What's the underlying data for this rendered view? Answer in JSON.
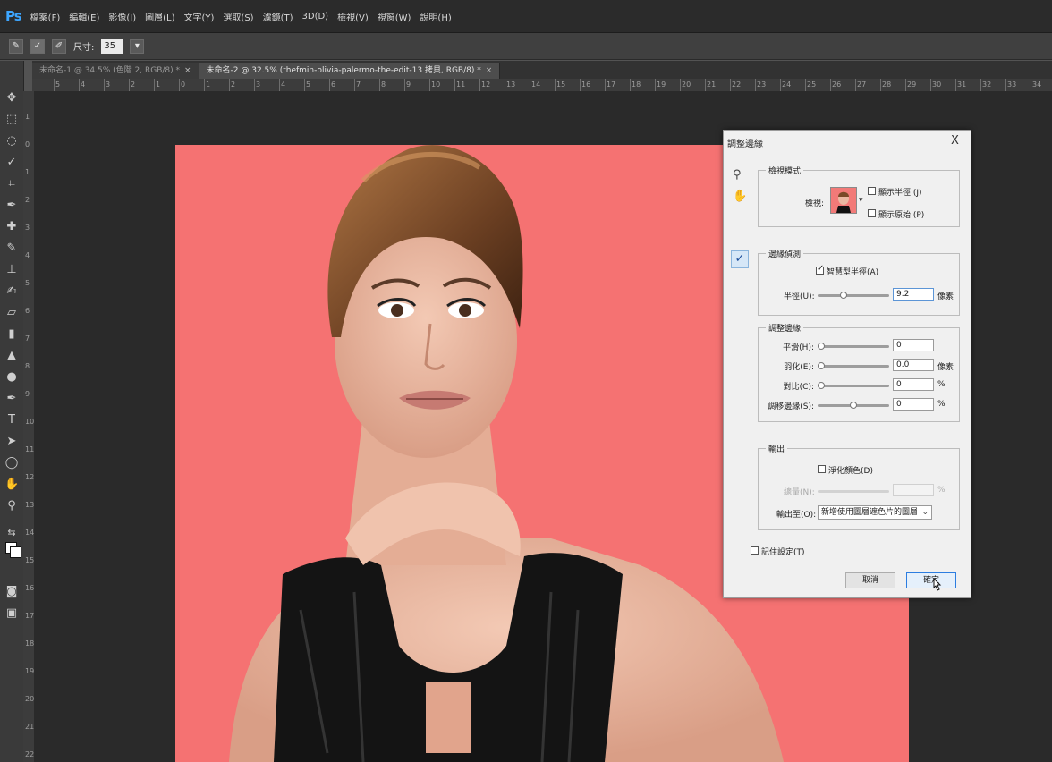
{
  "app": {
    "logo": "Ps"
  },
  "menu": [
    "檔案(F)",
    "編輯(E)",
    "影像(I)",
    "圖層(L)",
    "文字(Y)",
    "選取(S)",
    "濾鏡(T)",
    "3D(D)",
    "檢視(V)",
    "視窗(W)",
    "說明(H)"
  ],
  "options": {
    "size_label": "尺寸:",
    "size_value": "35"
  },
  "tabs": [
    {
      "label": "未命名-1 @ 34.5% (色階 2, RGB/8) *",
      "close": "×"
    },
    {
      "label": "未命名-2 @ 32.5% (thefmin-olivia-palermo-the-edit-13 拷貝, RGB/8) *",
      "close": "×"
    }
  ],
  "ruler": {
    "top": [
      "5",
      "4",
      "3",
      "2",
      "1",
      "0",
      "1",
      "2",
      "3",
      "4",
      "5",
      "6",
      "7",
      "8",
      "9",
      "10",
      "11",
      "12",
      "13",
      "14",
      "15",
      "16",
      "17",
      "18",
      "19",
      "20",
      "21",
      "22",
      "23",
      "24",
      "25",
      "26",
      "27",
      "28",
      "29",
      "30",
      "31",
      "32",
      "33",
      "34"
    ],
    "left": [
      "1",
      "0",
      "1",
      "2",
      "3",
      "4",
      "5",
      "6",
      "7",
      "8",
      "9",
      "10",
      "11",
      "12",
      "13",
      "14",
      "15",
      "16",
      "17",
      "18",
      "19",
      "20",
      "21",
      "22"
    ]
  },
  "canvas": {
    "background": "#f57272"
  },
  "dialog": {
    "title": "調整邊緣",
    "close": "X",
    "view_mode": {
      "group_title": "檢視模式",
      "view_label": "檢視:",
      "show_radius": "顯示半徑 (J)",
      "show_original": "顯示原始 (P)"
    },
    "edge_detection": {
      "group_title": "邊緣偵測",
      "smart_radius": "智慧型半徑(A)",
      "radius_label": "半徑(U):",
      "radius_value": "9.2",
      "radius_unit": "像素",
      "radius_level": 0.35
    },
    "adjust_edge": {
      "group_title": "調整邊緣",
      "rows": [
        {
          "label": "平滑(H):",
          "value": "0",
          "unit": "",
          "level": 0
        },
        {
          "label": "羽化(E):",
          "value": "0.0",
          "unit": "像素",
          "level": 0
        },
        {
          "label": "對比(C):",
          "value": "0",
          "unit": "%",
          "level": 0
        },
        {
          "label": "調移邊緣(S):",
          "value": "0",
          "unit": "%",
          "level": 0.5
        }
      ]
    },
    "output": {
      "group_title": "輸出",
      "decontaminate": "淨化顏色(D)",
      "amount_label": "總量(N):",
      "amount_unit": "%",
      "output_to_label": "輸出至(O):",
      "output_to_value": "新增使用圖層遮色片的圖層"
    },
    "remember": "記住設定(T)",
    "cancel": "取消",
    "ok": "確定"
  }
}
